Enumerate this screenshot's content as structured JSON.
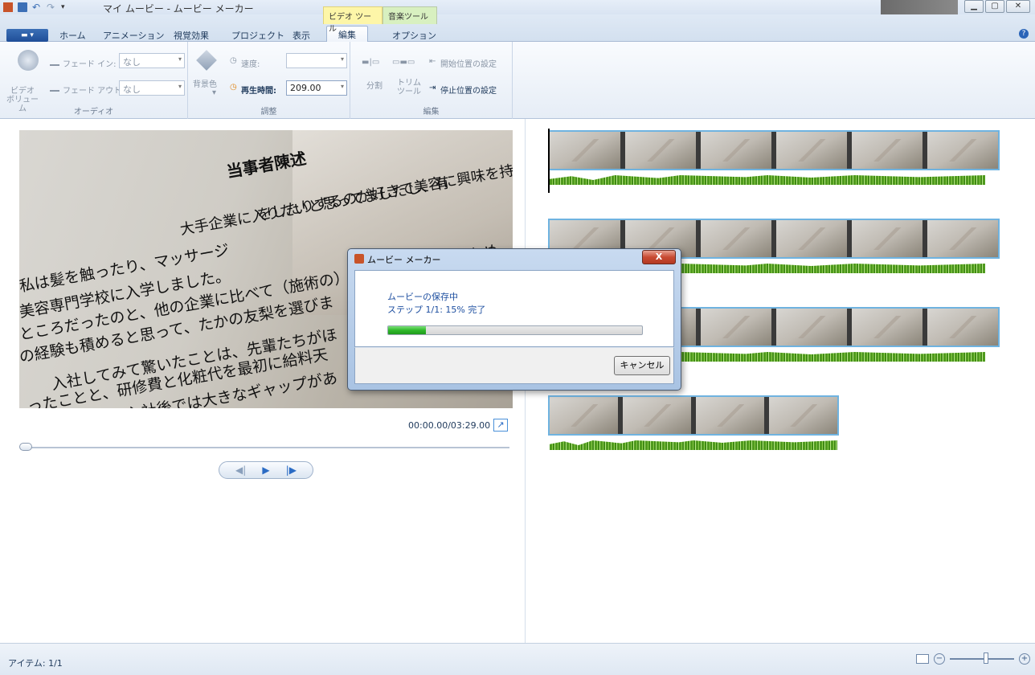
{
  "window": {
    "title": "マイ ムービー - ムービー メーカー",
    "contextual_tabs": [
      "ビデオ ツール",
      "音楽ツール"
    ],
    "controls": [
      "minimize",
      "maximize",
      "close"
    ]
  },
  "tabs": {
    "menu": "▬ ▾",
    "items": [
      "ホーム",
      "アニメーション",
      "視覚効果",
      "プロジェクト",
      "表示",
      "編集",
      "オプション"
    ],
    "active": "編集"
  },
  "ribbon": {
    "audio": {
      "volume_label": "ビデオ\nボリューム",
      "fade_in_label": "フェード イン:",
      "fade_in_value": "なし",
      "fade_out_label": "フェード アウト:",
      "fade_out_value": "なし",
      "group": "オーディオ"
    },
    "adjust": {
      "bg_label": "背景色",
      "speed_label": "速度:",
      "speed_value": "",
      "duration_label": "再生時間:",
      "duration_value": "209.00",
      "group": "調整"
    },
    "edit": {
      "split_label": "分割",
      "trim_label": "トリム\nツール",
      "set_start": "開始位置の設定",
      "set_end": "停止位置の設定",
      "group": "編集"
    }
  },
  "preview": {
    "title": "当事者陳述",
    "lines": [
      "をしたりするのが好きで美容に興味を持",
      "大手企業に入りたいと思ってましたし、有",
      "私は髪を触ったり、マッサージ",
      "美容専門学校に入学しました。",
      "ところだったのと、他の企業に比べて（施術の）コースの数が多いため、",
      "の経験も積めると思って、たかの友梨を選びま",
      "入社してみて驚いたことは、先輩たちがほ",
      "ったことと、研修費と化粧代を最初に給料天",
      "（社前と）入社後では大きなギャップがあ"
    ],
    "timecode": "00:00.00/03:29.00"
  },
  "dialog": {
    "title": "ムービー メーカー",
    "close": "X",
    "message": "ムービーの保存中",
    "step": "ステップ 1/1: 15% 完了",
    "progress": 0.15,
    "cancel": "キャンセル"
  },
  "status": {
    "items": "アイテム: 1/1"
  }
}
